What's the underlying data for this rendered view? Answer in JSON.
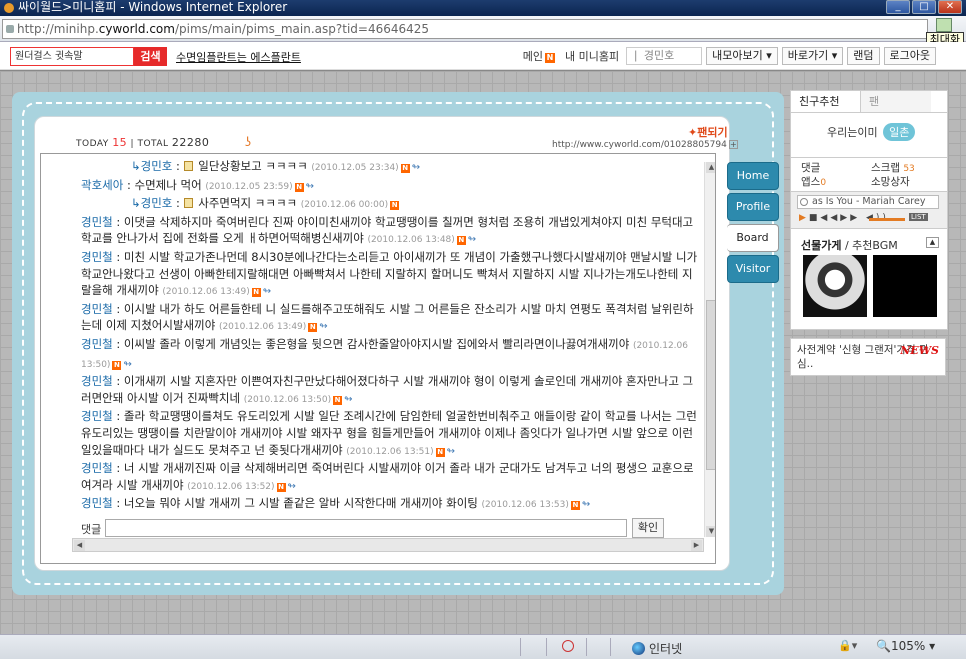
{
  "browser": {
    "title": "싸이월드>미니홈피 - Windows Internet Explorer",
    "url_prefix": "http://minihp.",
    "url_domain": "cyworld.com",
    "url_path": "/pims/main/pims_main.asp?tid=46646425",
    "tooltip": "최대화",
    "status_zone": "인터넷",
    "zoom": "105%"
  },
  "topnav": {
    "search_value": "원더걸스 귓속말",
    "search_button": "검색",
    "promo": "수면임플란트는 에스플란트",
    "main": "메인",
    "my_minihompy": "내 미니홈피",
    "friend_input": "경민호",
    "collect": "내모아보기",
    "shortcut": "바로가기",
    "random": "랜덤",
    "logout": "로그아웃"
  },
  "header": {
    "today_label": "TODAY",
    "today_count": "15",
    "total_label": "TOTAL",
    "total_count": "22280",
    "fan_link": "✦팬되기",
    "url": "http://www.cyworld.com/01028805794"
  },
  "comments": [
    {
      "name": "경민호",
      "text": " 일단상황보고 ㅋㅋㅋㅋ ",
      "date": "(2010.12.05 23:34)",
      "reply": true,
      "memo": true
    },
    {
      "name": "곽호세아",
      "text": " : 수면제나 먹어 ",
      "date": "(2010.12.05 23:59)",
      "reply": false,
      "memo": false
    },
    {
      "name": "경민호",
      "text": " 사주면먹지 ㅋㅋㅋㅋ ",
      "date": "(2010.12.06 00:00)",
      "reply": true,
      "memo": true
    },
    {
      "name": "경민철",
      "text": " : 이댓글 삭제하지마 죽여버린다 진짜 야이미친새끼야 학교땡땡이를 칠꺼면 형처럼 조용히 개냅있게쳐야지 미친 무턱대고 학교를 안나가서 집에 전화를 오게 ㅐ하면어떡해병신새끼야 ",
      "date": "(2010.12.06 13:48)",
      "reply": false,
      "memo": false
    },
    {
      "name": "경민철",
      "text": " : 미친 시발 학교가존나먼데 8시30분에나간다는소리듣고 아이새끼가 또 개념이 가출했구나했다시발새끼야 맨날시발 니가 학교안나왔다고 선생이 아빠한테지랄해대면 아빠빡쳐서 나한테 지랄하지 할머니도 빡쳐서 지랄하지 시발 지나가는개도나한테 지랄을해 개새끼야 ",
      "date": "(2010.12.06 13:49)",
      "reply": false,
      "memo": false
    },
    {
      "name": "경민철",
      "text": " : 이시발 내가 하도 어른들한테 니 실드를해주고또해줘도 시발 그 어른들은 잔소리가 시발 마치 연평도 폭격처럼 날위린하는데 이제 지쳤어시발새끼야 ",
      "date": "(2010.12.06 13:49)",
      "reply": false,
      "memo": false
    },
    {
      "name": "경민철",
      "text": " : 이씨발 졸라 이렇게 개념잇는 좋은형을 뒷으면 감사한줄알아야지시발 집에와서 빨리라면이나끓여개새끼야 ",
      "date": "(2010.12.06 13:50)",
      "reply": false,
      "memo": false
    },
    {
      "name": "경민철",
      "text": " : 이개새끼 시발 지혼자만 이쁜여자친구만났다해어졌다하구 시발 개새끼야 형이 이렇게 솔로인데 개새끼야 혼자만나고 그러면안돼 아시발 이거 진짜빡치네 ",
      "date": "(2010.12.06 13:50)",
      "reply": false,
      "memo": false
    },
    {
      "name": "경민철",
      "text": " : 졸라 학교땡땡이를쳐도 유도리있게 시발 일단 조례시간에 담임한테 얼굴한번비춰주고 애들이랑 같이 학교를 나서는 그런 유도리있는 땡땡이를 치란말이야 개새끼야 시발 왜자꾸 형을 힘들게만들어 개새끼야 이제나 좀잇다가 일나가면 시발 앞으로 이런일있을때마다 내가 실드도 못쳐주고 넌 좆됫다개새끼야 ",
      "date": "(2010.12.06 13:51)",
      "reply": false,
      "memo": false
    },
    {
      "name": "경민철",
      "text": " : 너 시발 개새끼진짜 이글 삭제해버리면 죽여버린다 시발새끼야 이거 졸라 내가 군대가도 남겨두고 너의 평생으 교훈으로 여겨라 시발 개새끼야 ",
      "date": "(2010.12.06 13:52)",
      "reply": false,
      "memo": false
    },
    {
      "name": "경민철",
      "text": " : 너오늘 뭐야 시발 개새끼 그 시발 좉같은 알바 시작한다매 개새끼야 화이팅 ",
      "date": "(2010.12.06 13:53)",
      "reply": false,
      "memo": false
    }
  ],
  "reply_form": {
    "label": "댓글",
    "confirm": "확인"
  },
  "menu": [
    "Home",
    "Profile",
    "Board",
    "Visitor"
  ],
  "right_panel": {
    "tab_recommend": "친구추천",
    "tab_fan": "팬",
    "we_are": "우리는이미",
    "relation": "일촌",
    "comment_label": "댓글",
    "scrap_label": "스크랩",
    "scrap_count": "53",
    "app_label": "앱스",
    "app_count": "0",
    "shop_label": "소망상자",
    "song": "as Is You - Mariah Carey",
    "list_label": "LIST",
    "gift_label": "선물가게",
    "bgm_label": "/ 추천BGM",
    "news_text": "사전계약 '신형 그랜저'가격 관심..",
    "news_tag": "NEWS"
  },
  "icons": {
    "new_badge": "N",
    "share": "↬",
    "reply_arrow": "↳"
  }
}
